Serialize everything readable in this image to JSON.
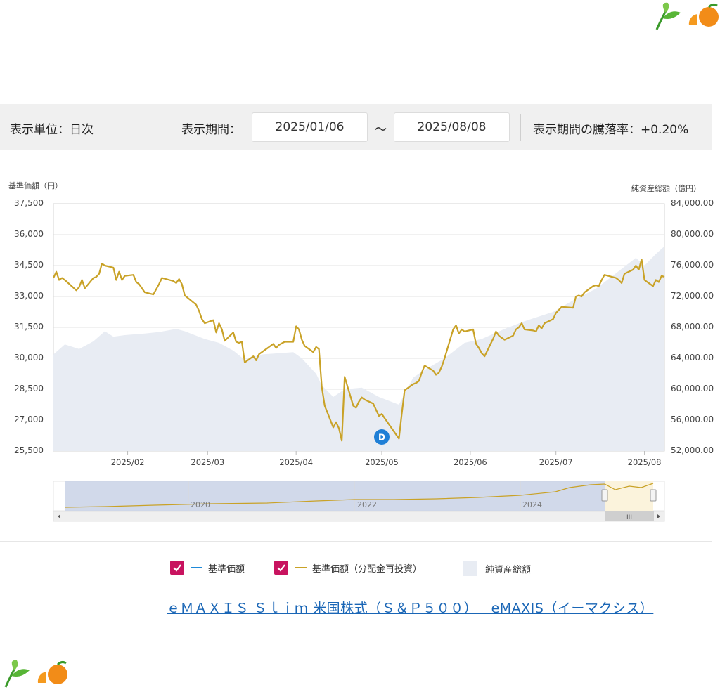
{
  "controls": {
    "unit_label": "表示単位：日次",
    "period_label": "表示期間：",
    "start_date": "2025/01/06",
    "tilde": "～",
    "end_date": "2025/08/08",
    "change_label": "表示期間の騰落率：+0.20%"
  },
  "legend": {
    "item1": "基準価額",
    "item2": "基準価額（分配金再投資）",
    "item3": "純資産総額",
    "checkbox_color": "#c8135f",
    "line1_color": "#1f8ad9",
    "line2_color": "#c9a227",
    "area_color": "#e8ecf3"
  },
  "link_text": "ｅＭＡＸＩＳ Ｓｌｉｍ 米国株式（Ｓ＆Ｐ５００）｜eMAXIS（イーマクシス）",
  "marker_label": "D",
  "navigator": {
    "labels": [
      "2020",
      "2022",
      "2024"
    ],
    "scroll_grip": "III"
  },
  "chart_data": {
    "type": "line",
    "left_axis_title": "基準価額（円）",
    "right_axis_title": "純資産総額（億円）",
    "ylim_left": [
      25500,
      37500
    ],
    "ylim_right": [
      52000,
      84000
    ],
    "yticks_left": [
      "37,500",
      "36,000",
      "34,500",
      "33,000",
      "31,500",
      "30,000",
      "28,500",
      "27,000",
      "25,500"
    ],
    "yticks_right": [
      "84,000.00",
      "80,000.00",
      "76,000.00",
      "72,000.00",
      "68,000.00",
      "64,000.00",
      "60,000.00",
      "56,000.00",
      "52,000.00"
    ],
    "xticks": [
      "2025/02",
      "2025/03",
      "2025/04",
      "2025/05",
      "2025/06",
      "2025/07",
      "2025/08"
    ],
    "x_range": [
      "2025/01/06",
      "2025/08/08"
    ],
    "grid": true,
    "series": [
      {
        "name": "基準価額（分配金再投資）",
        "color": "#c9a227",
        "axis": "left",
        "points": [
          [
            "2025-01-06",
            33900
          ],
          [
            "2025-01-07",
            34200
          ],
          [
            "2025-01-08",
            33800
          ],
          [
            "2025-01-09",
            33900
          ],
          [
            "2025-01-10",
            33800
          ],
          [
            "2025-01-14",
            33300
          ],
          [
            "2025-01-15",
            33450
          ],
          [
            "2025-01-16",
            33800
          ],
          [
            "2025-01-17",
            33400
          ],
          [
            "2025-01-20",
            33900
          ],
          [
            "2025-01-21",
            33950
          ],
          [
            "2025-01-22",
            34100
          ],
          [
            "2025-01-23",
            34600
          ],
          [
            "2025-01-24",
            34500
          ],
          [
            "2025-01-27",
            34400
          ],
          [
            "2025-01-28",
            33800
          ],
          [
            "2025-01-29",
            34200
          ],
          [
            "2025-01-30",
            33800
          ],
          [
            "2025-01-31",
            34000
          ],
          [
            "2025-02-03",
            34050
          ],
          [
            "2025-02-04",
            33700
          ],
          [
            "2025-02-05",
            33600
          ],
          [
            "2025-02-06",
            33400
          ],
          [
            "2025-02-07",
            33200
          ],
          [
            "2025-02-10",
            33100
          ],
          [
            "2025-02-12",
            33600
          ],
          [
            "2025-02-13",
            33900
          ],
          [
            "2025-02-17",
            33750
          ],
          [
            "2025-02-18",
            33650
          ],
          [
            "2025-02-19",
            33850
          ],
          [
            "2025-02-20",
            33600
          ],
          [
            "2025-02-21",
            33050
          ],
          [
            "2025-02-25",
            32600
          ],
          [
            "2025-02-26",
            32300
          ],
          [
            "2025-02-27",
            31900
          ],
          [
            "2025-02-28",
            31700
          ],
          [
            "2025-03-03",
            31850
          ],
          [
            "2025-03-04",
            31250
          ],
          [
            "2025-03-05",
            31700
          ],
          [
            "2025-03-06",
            31400
          ],
          [
            "2025-03-07",
            30850
          ],
          [
            "2025-03-10",
            31250
          ],
          [
            "2025-03-11",
            30800
          ],
          [
            "2025-03-12",
            30750
          ],
          [
            "2025-03-13",
            30800
          ],
          [
            "2025-03-14",
            29800
          ],
          [
            "2025-03-17",
            30100
          ],
          [
            "2025-03-18",
            29900
          ],
          [
            "2025-03-19",
            30200
          ],
          [
            "2025-03-21",
            30400
          ],
          [
            "2025-03-24",
            30700
          ],
          [
            "2025-03-25",
            30500
          ],
          [
            "2025-03-26",
            30650
          ],
          [
            "2025-03-28",
            30800
          ],
          [
            "2025-03-31",
            30800
          ],
          [
            "2025-04-01",
            31550
          ],
          [
            "2025-04-02",
            31400
          ],
          [
            "2025-04-03",
            30900
          ],
          [
            "2025-04-04",
            30600
          ],
          [
            "2025-04-07",
            30300
          ],
          [
            "2025-04-08",
            30550
          ],
          [
            "2025-04-09",
            30450
          ],
          [
            "2025-04-10",
            28600
          ],
          [
            "2025-04-11",
            27700
          ],
          [
            "2025-04-14",
            26650
          ],
          [
            "2025-04-15",
            26900
          ],
          [
            "2025-04-16",
            26600
          ],
          [
            "2025-04-17",
            26000
          ],
          [
            "2025-04-18",
            29100
          ],
          [
            "2025-04-21",
            27700
          ],
          [
            "2025-04-22",
            27600
          ],
          [
            "2025-04-23",
            27900
          ],
          [
            "2025-04-24",
            28100
          ],
          [
            "2025-04-25",
            28000
          ],
          [
            "2025-04-28",
            27800
          ],
          [
            "2025-04-30",
            27200
          ],
          [
            "2025-05-01",
            27300
          ],
          [
            "2025-05-02",
            27100
          ],
          [
            "2025-05-07",
            26100
          ],
          [
            "2025-05-08",
            27300
          ],
          [
            "2025-05-09",
            28450
          ],
          [
            "2025-05-12",
            28750
          ],
          [
            "2025-05-13",
            28800
          ],
          [
            "2025-05-14",
            28900
          ],
          [
            "2025-05-15",
            29300
          ],
          [
            "2025-05-16",
            29650
          ],
          [
            "2025-05-19",
            29400
          ],
          [
            "2025-05-20",
            29200
          ],
          [
            "2025-05-21",
            29300
          ],
          [
            "2025-05-22",
            29600
          ],
          [
            "2025-05-23",
            30000
          ],
          [
            "2025-05-26",
            31400
          ],
          [
            "2025-05-27",
            31600
          ],
          [
            "2025-05-28",
            31200
          ],
          [
            "2025-05-29",
            31400
          ],
          [
            "2025-05-30",
            31300
          ],
          [
            "2025-06-02",
            31400
          ],
          [
            "2025-06-03",
            30700
          ],
          [
            "2025-06-04",
            30500
          ],
          [
            "2025-06-05",
            30250
          ],
          [
            "2025-06-06",
            30100
          ],
          [
            "2025-06-09",
            30950
          ],
          [
            "2025-06-10",
            31300
          ],
          [
            "2025-06-11",
            31100
          ],
          [
            "2025-06-12",
            31000
          ],
          [
            "2025-06-13",
            30900
          ],
          [
            "2025-06-16",
            31100
          ],
          [
            "2025-06-17",
            31400
          ],
          [
            "2025-06-18",
            31500
          ],
          [
            "2025-06-19",
            31700
          ],
          [
            "2025-06-20",
            31400
          ],
          [
            "2025-06-23",
            31350
          ],
          [
            "2025-06-24",
            31300
          ],
          [
            "2025-06-25",
            31600
          ],
          [
            "2025-06-26",
            31450
          ],
          [
            "2025-06-27",
            31700
          ],
          [
            "2025-06-30",
            31900
          ],
          [
            "2025-07-01",
            32200
          ],
          [
            "2025-07-02",
            32350
          ],
          [
            "2025-07-03",
            32500
          ],
          [
            "2025-07-07",
            32450
          ],
          [
            "2025-07-08",
            33000
          ],
          [
            "2025-07-09",
            33050
          ],
          [
            "2025-07-10",
            33000
          ],
          [
            "2025-07-11",
            33200
          ],
          [
            "2025-07-14",
            33500
          ],
          [
            "2025-07-15",
            33550
          ],
          [
            "2025-07-16",
            33500
          ],
          [
            "2025-07-17",
            33800
          ],
          [
            "2025-07-18",
            34050
          ],
          [
            "2025-07-22",
            33900
          ],
          [
            "2025-07-23",
            33800
          ],
          [
            "2025-07-24",
            33650
          ],
          [
            "2025-07-25",
            34100
          ],
          [
            "2025-07-28",
            34300
          ],
          [
            "2025-07-29",
            34500
          ],
          [
            "2025-07-30",
            34300
          ],
          [
            "2025-07-31",
            34800
          ],
          [
            "2025-08-01",
            33800
          ],
          [
            "2025-08-04",
            33500
          ],
          [
            "2025-08-05",
            33800
          ],
          [
            "2025-08-06",
            33700
          ],
          [
            "2025-08-07",
            34000
          ],
          [
            "2025-08-08",
            33950
          ]
        ]
      },
      {
        "name": "純資産総額",
        "color": "#e8ecf3",
        "axis": "right",
        "type": "area",
        "points": [
          [
            "2025-01-06",
            64500
          ],
          [
            "2025-01-10",
            65800
          ],
          [
            "2025-01-15",
            65200
          ],
          [
            "2025-01-20",
            66200
          ],
          [
            "2025-01-24",
            67500
          ],
          [
            "2025-01-27",
            66800
          ],
          [
            "2025-01-31",
            67000
          ],
          [
            "2025-02-07",
            67200
          ],
          [
            "2025-02-12",
            67400
          ],
          [
            "2025-02-18",
            67800
          ],
          [
            "2025-02-21",
            67500
          ],
          [
            "2025-02-28",
            66500
          ],
          [
            "2025-03-05",
            66000
          ],
          [
            "2025-03-10",
            65000
          ],
          [
            "2025-03-14",
            63800
          ],
          [
            "2025-03-20",
            64500
          ],
          [
            "2025-03-31",
            64800
          ],
          [
            "2025-04-03",
            64000
          ],
          [
            "2025-04-08",
            62000
          ],
          [
            "2025-04-10",
            60500
          ],
          [
            "2025-04-14",
            59000
          ],
          [
            "2025-04-18",
            60000
          ],
          [
            "2025-04-24",
            60200
          ],
          [
            "2025-04-30",
            59000
          ],
          [
            "2025-05-07",
            58000
          ],
          [
            "2025-05-12",
            61500
          ],
          [
            "2025-05-16",
            62500
          ],
          [
            "2025-05-23",
            64000
          ],
          [
            "2025-05-30",
            66000
          ],
          [
            "2025-06-05",
            66500
          ],
          [
            "2025-06-13",
            67800
          ],
          [
            "2025-06-20",
            68800
          ],
          [
            "2025-06-30",
            70000
          ],
          [
            "2025-07-07",
            71500
          ],
          [
            "2025-07-15",
            73000
          ],
          [
            "2025-07-22",
            75000
          ],
          [
            "2025-07-29",
            77000
          ],
          [
            "2025-08-01",
            76000
          ],
          [
            "2025-08-05",
            77500
          ],
          [
            "2025-08-08",
            78500
          ]
        ]
      }
    ],
    "annotation": {
      "date": "2025-05-01",
      "label": "D"
    }
  }
}
